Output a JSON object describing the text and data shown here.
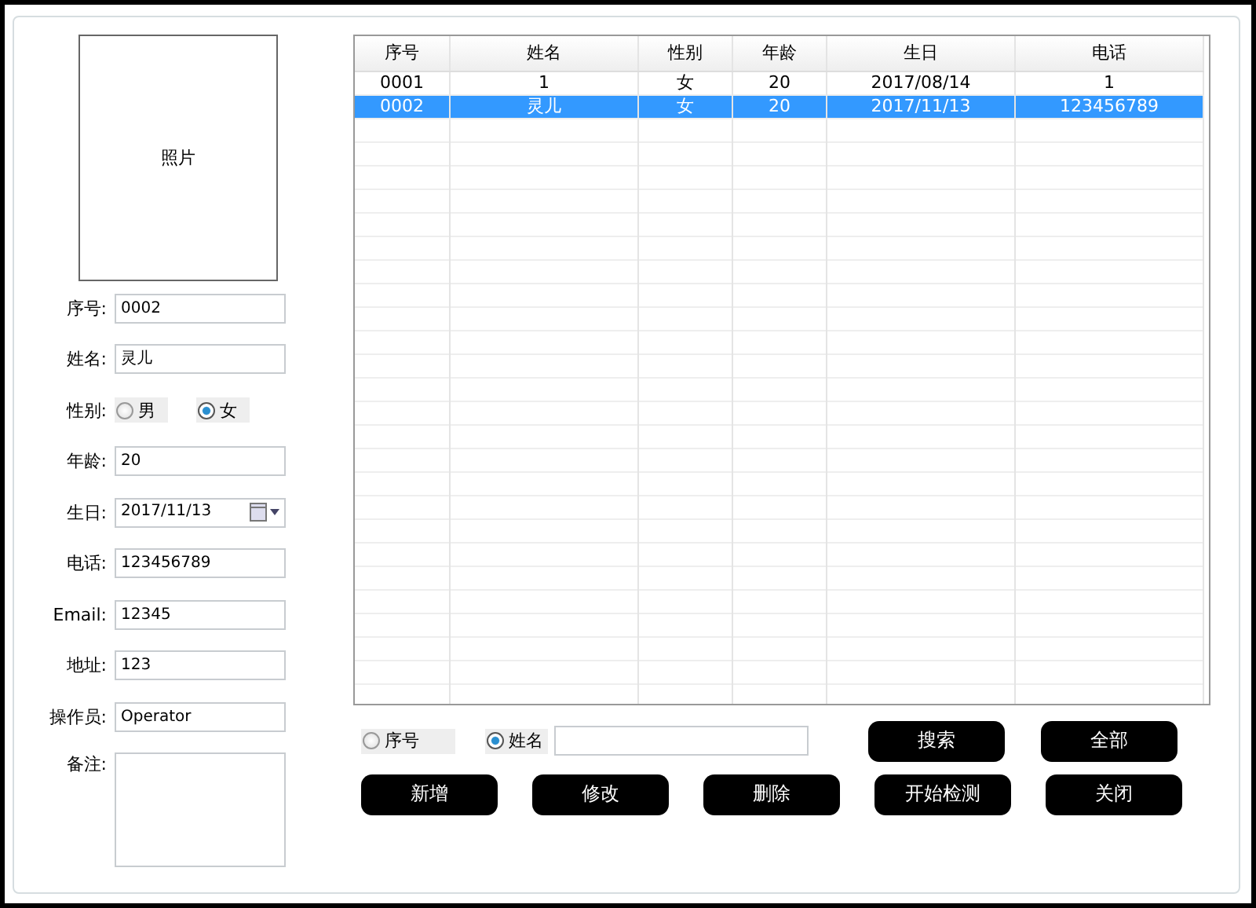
{
  "photo": {
    "label": "照片"
  },
  "form": [
    {
      "kind": "text",
      "label": "序号:",
      "value": "0002"
    },
    {
      "kind": "text",
      "label": "姓名:",
      "value": "灵儿"
    },
    {
      "kind": "radio",
      "label": "性别:",
      "options": [
        {
          "label": "男",
          "selected": false
        },
        {
          "label": "女",
          "selected": true
        }
      ]
    },
    {
      "kind": "text",
      "label": "年龄:",
      "value": "20"
    },
    {
      "kind": "date",
      "label": "生日:",
      "value": "2017/11/13"
    },
    {
      "kind": "text",
      "label": "电话:",
      "value": "123456789"
    },
    {
      "kind": "text",
      "label": "Email:",
      "value": "12345"
    },
    {
      "kind": "text",
      "label": "地址:",
      "value": "123"
    },
    {
      "kind": "text",
      "label": "操作员:",
      "value": "Operator"
    },
    {
      "kind": "memo",
      "label": "备注:"
    }
  ],
  "table": {
    "columns": [
      "序号",
      "姓名",
      "性别",
      "年龄",
      "生日",
      "电话"
    ],
    "rows": [
      {
        "cells": [
          "0001",
          "1",
          "女",
          "20",
          "2017/08/14",
          "1"
        ],
        "selected": false
      },
      {
        "cells": [
          "0002",
          "灵儿",
          "女",
          "20",
          "2017/11/13",
          "123456789"
        ],
        "selected": true
      }
    ]
  },
  "search": {
    "options": [
      {
        "label": "序号",
        "selected": false
      },
      {
        "label": "姓名",
        "selected": true
      }
    ]
  },
  "buttons_top": [
    "搜索",
    "全部"
  ],
  "buttons_bottom": [
    "新增",
    "修改",
    "删除",
    "开始检测",
    "关闭"
  ]
}
